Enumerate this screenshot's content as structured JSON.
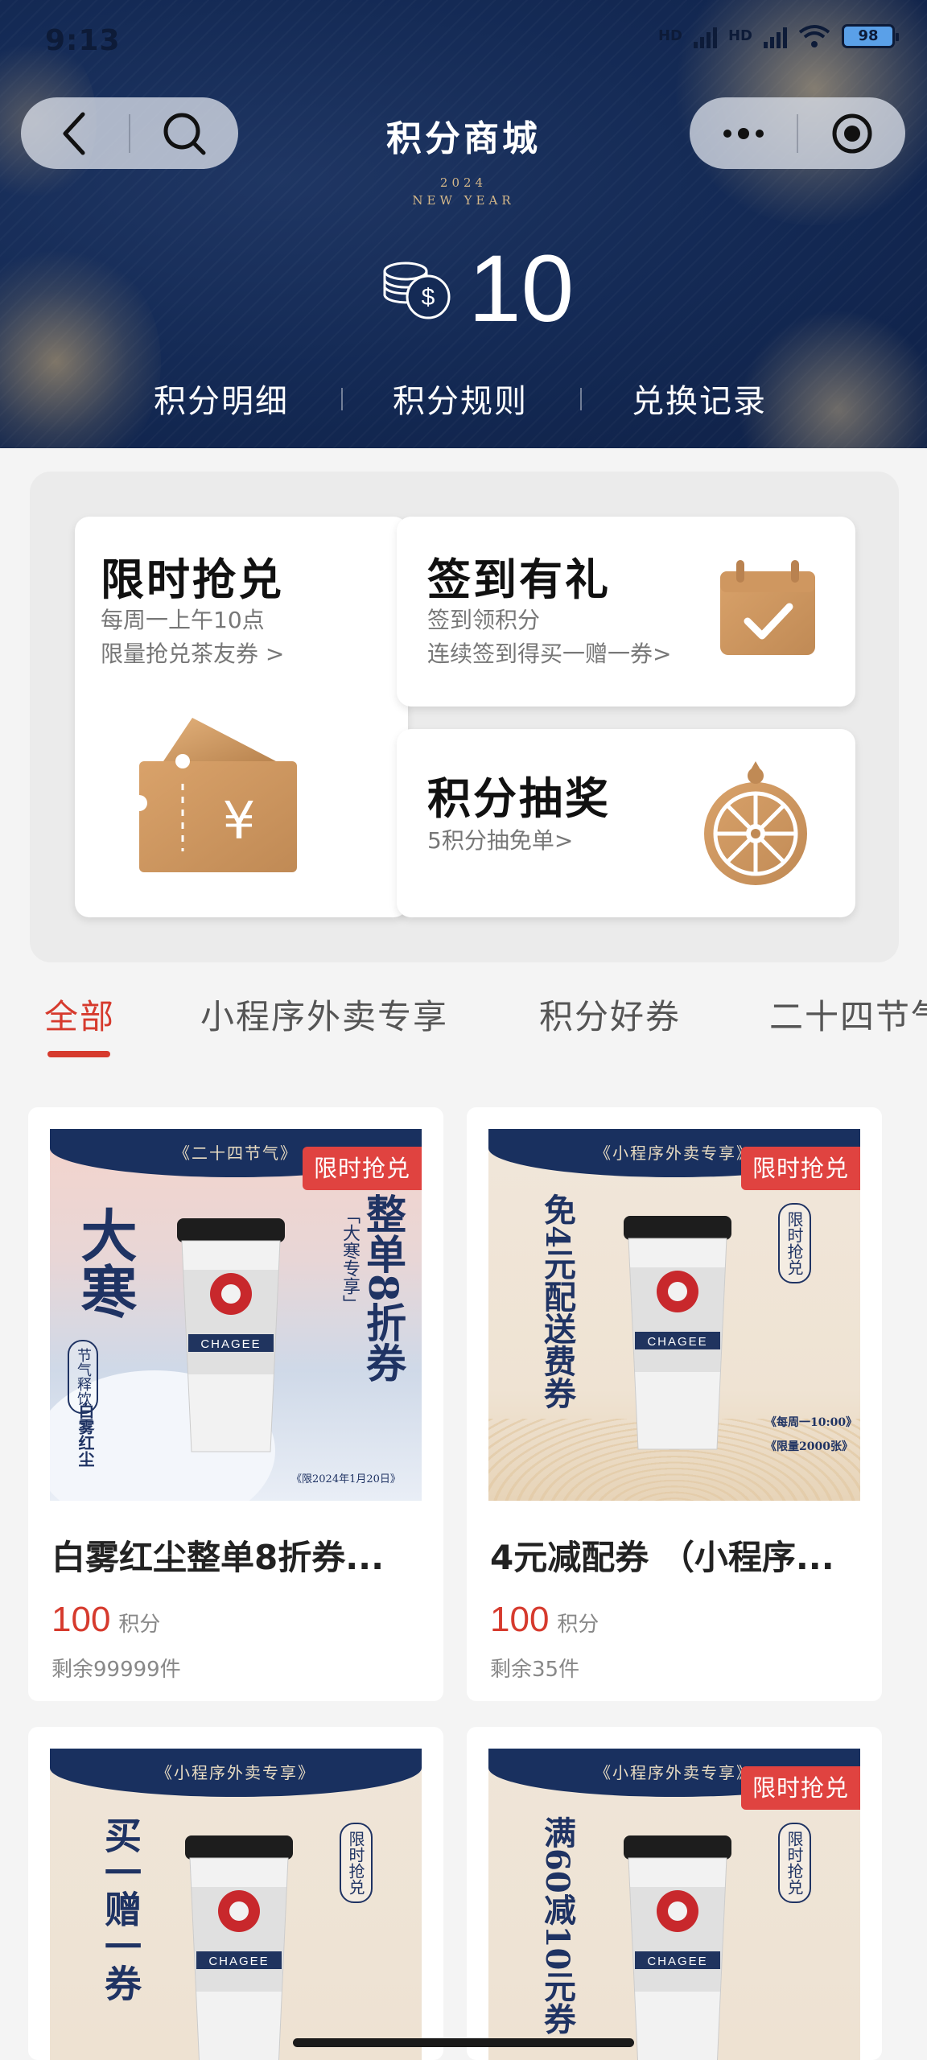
{
  "status": {
    "time": "9:13",
    "net1": "HD",
    "net2": "HD",
    "battery": "98"
  },
  "header": {
    "title": "积分商城",
    "year_line1": "2024",
    "year_line2": "NEW YEAR",
    "points_value": "10",
    "nav": [
      "积分明细",
      "积分规则",
      "兑换记录"
    ]
  },
  "features": {
    "flash": {
      "title": "限时抢兑",
      "line1": "每周一上午10点",
      "line2": "限量抢兑茶友券 >"
    },
    "checkin": {
      "title": "签到有礼",
      "line1": "签到领积分",
      "line2": "连续签到得买一赠一券>"
    },
    "lottery": {
      "title": "积分抽奖",
      "line1": "5积分抽免单>"
    }
  },
  "tabs": [
    "全部",
    "小程序外卖专享",
    "积分好券",
    "二十四节气"
  ],
  "products": [
    {
      "name": "白雾红尘整单8折券...",
      "price": "100",
      "unit": "积分",
      "stock": "剩余99999件",
      "badge": "限时抢兑",
      "img": {
        "caption": "《二十四节气》",
        "big": "大寒",
        "headline": "整单8折券",
        "tag": "「大寒专享」",
        "small1": "节气释饮",
        "small2": "白雾红尘",
        "note": "《限2024年1月20日》",
        "cup_brand": "CHAGEE"
      }
    },
    {
      "name": "4元减配券 （小程序...",
      "price": "100",
      "unit": "积分",
      "stock": "剩余35件",
      "badge": "限时抢兑",
      "img": {
        "caption": "《小程序外卖专享》",
        "headline": "免4元配送费券",
        "stamp": "限时抢兑",
        "note1": "《每周一10:00》",
        "note2": "《限量2000张》",
        "cup_brand": "CHAGEE"
      }
    },
    {
      "img": {
        "caption": "《小程序外卖专享》",
        "headline": "买一赠一券",
        "stamp": "限时抢兑",
        "cup_brand": "CHAGEE"
      }
    },
    {
      "badge": "限时抢兑",
      "img": {
        "caption": "《小程序外卖专享》",
        "headline": "满60减10元券",
        "stamp": "限时抢兑",
        "cup_brand": "CHAGEE"
      }
    }
  ],
  "colors": {
    "accent_red": "#d63a2d",
    "navy": "#142a55",
    "gold": "#c9935a"
  },
  "icons": [
    "back-icon",
    "search-icon",
    "more-icon",
    "target-icon",
    "coin-icon",
    "ticket-icon",
    "calendar-icon",
    "wheel-icon"
  ]
}
